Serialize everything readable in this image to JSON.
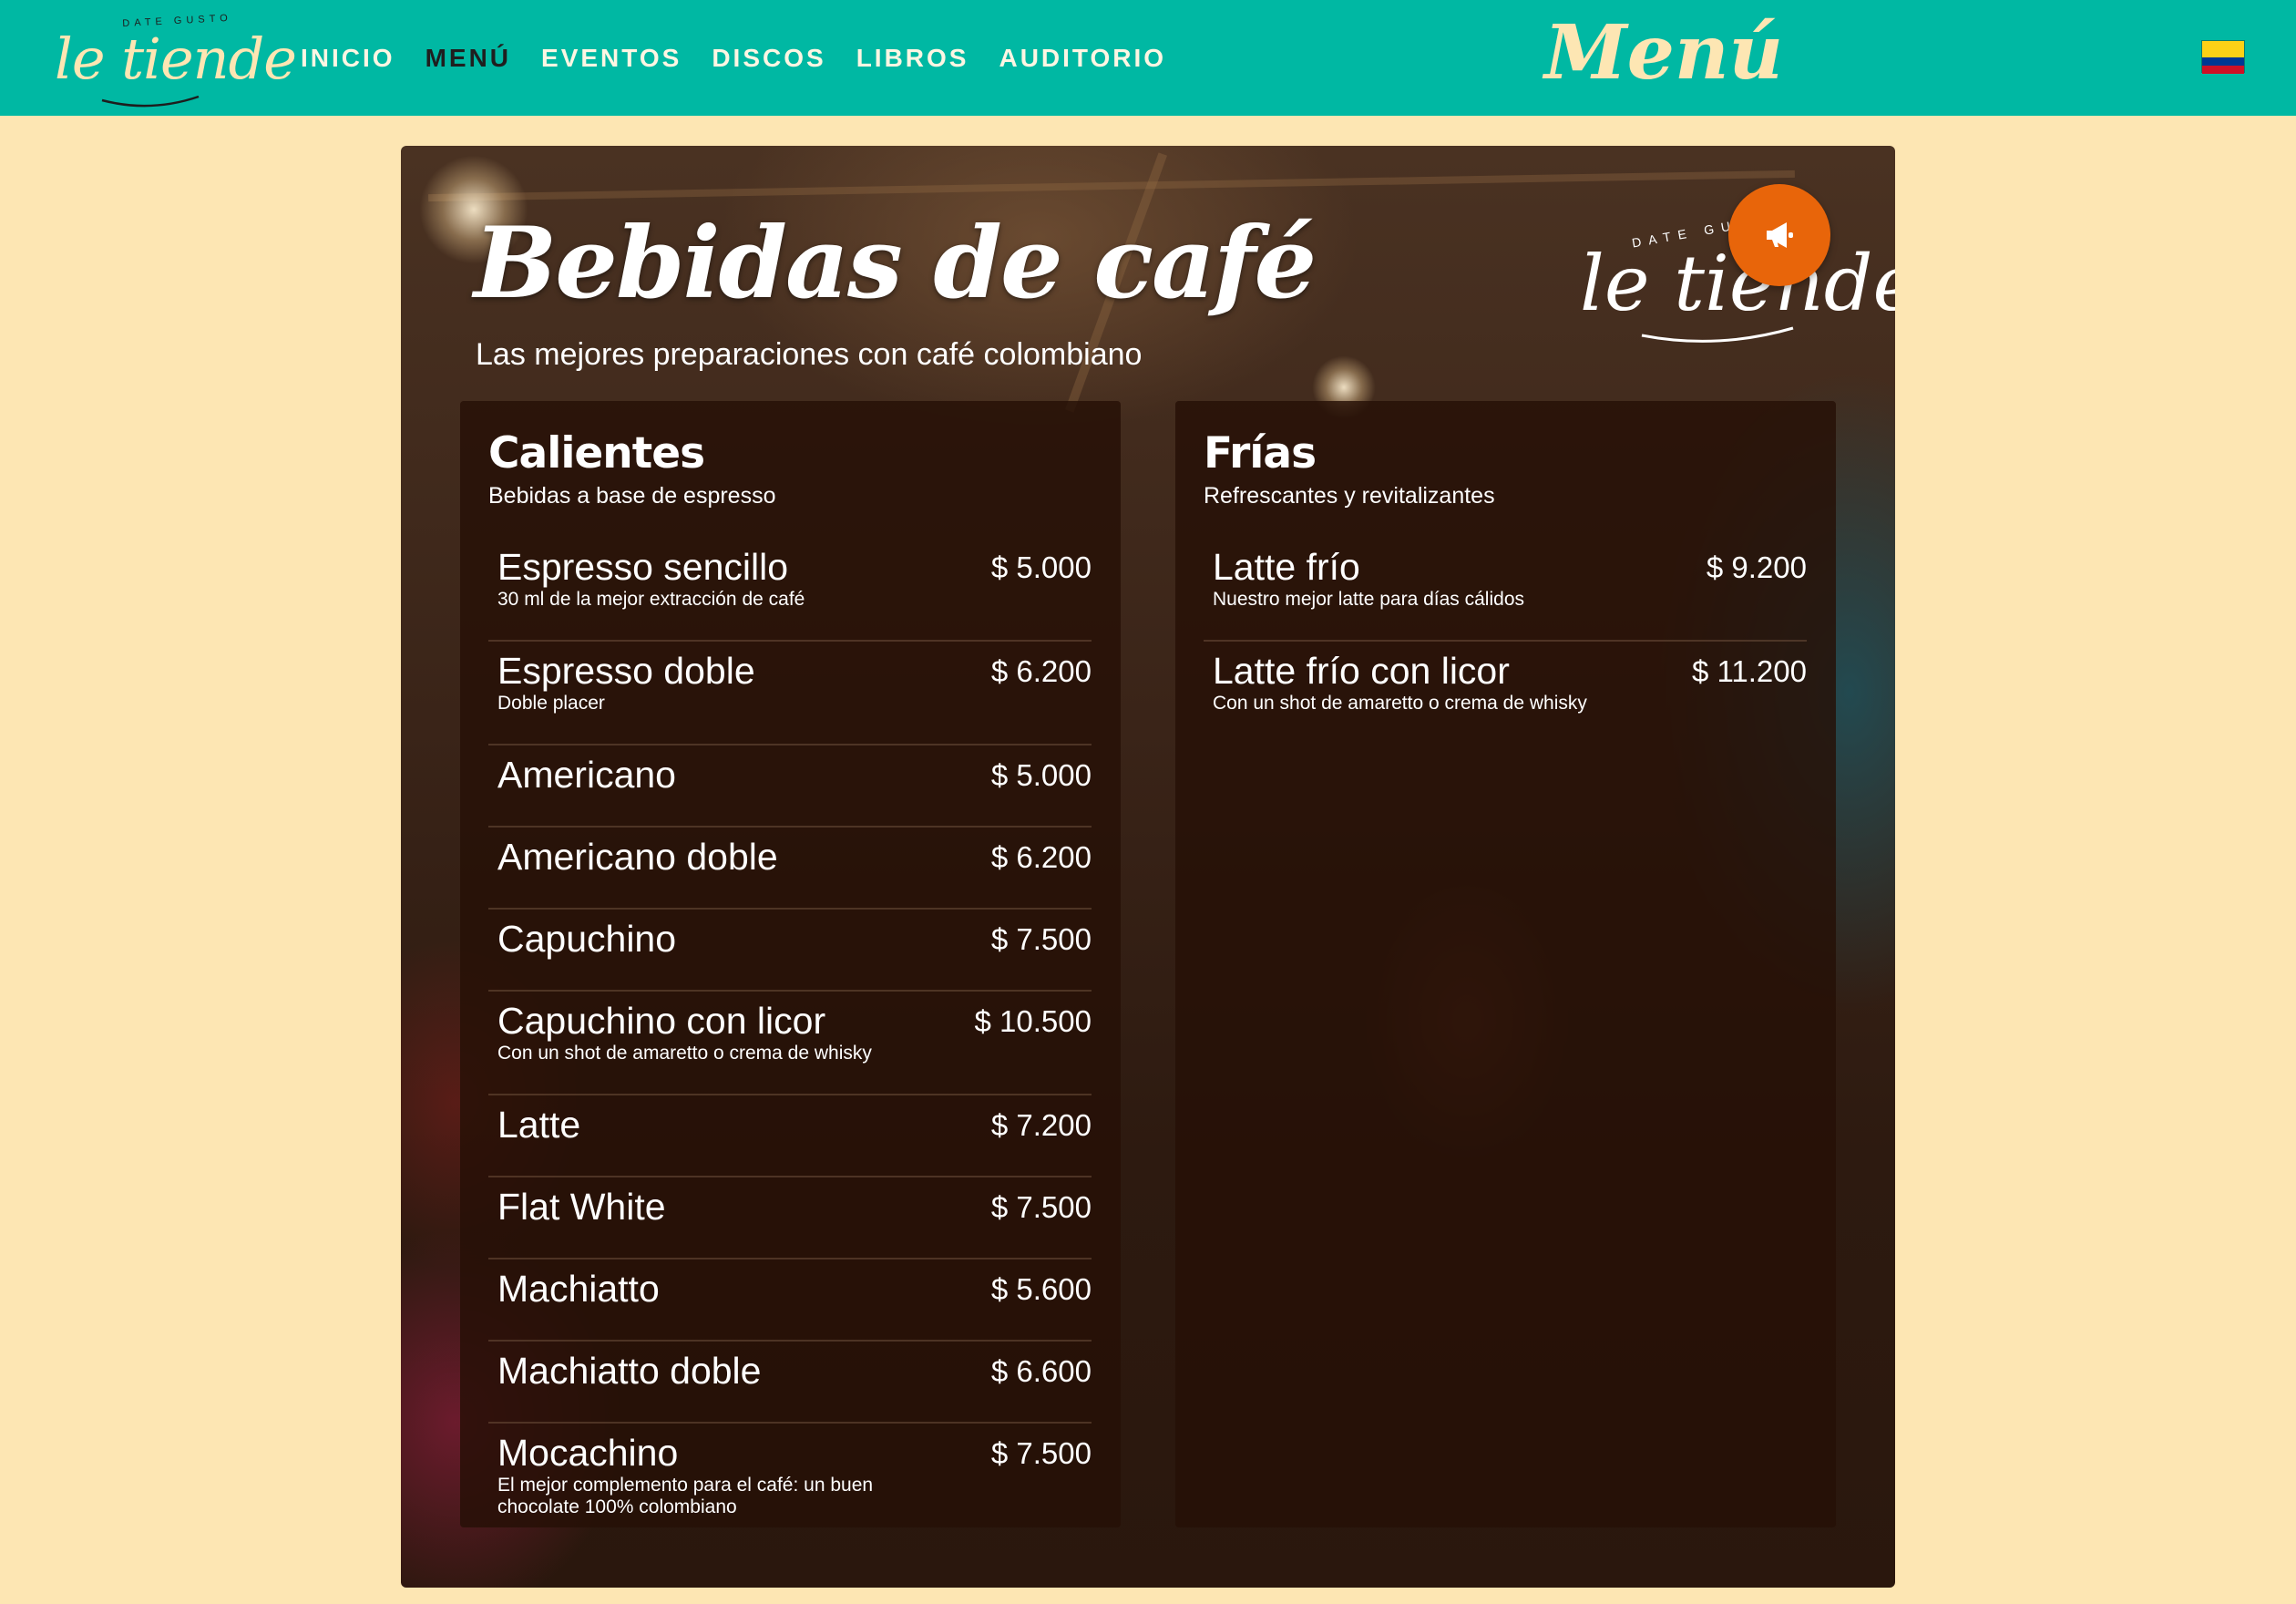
{
  "nav": {
    "brand_tag": "DATE GUSTO",
    "brand_name": "le tiende",
    "links": [
      "INICIO",
      "MENÚ",
      "EVENTOS",
      "DISCOS",
      "LIBROS",
      "AUDITORIO"
    ],
    "active_link": "MENÚ",
    "page_title": "Menú",
    "language_flag": "colombia-flag",
    "colors": {
      "bar": "#00b8a3",
      "brand": "#fde6b3"
    }
  },
  "panel": {
    "title": "Bebidas de café",
    "subtitle": "Las mejores preparaciones con café colombiano",
    "logo_tag": "DATE GUSTO",
    "logo_name": "le tiende",
    "announce_icon": "megaphone-icon",
    "announce_color": "#e8650a"
  },
  "calientes": {
    "title": "Calientes",
    "subtitle": "Bebidas a base de espresso",
    "items": [
      {
        "name": "Espresso sencillo",
        "desc": "30 ml de la mejor extracción de café",
        "price": "$ 5.000"
      },
      {
        "name": "Espresso doble",
        "desc": "Doble placer",
        "price": "$ 6.200"
      },
      {
        "name": "Americano",
        "desc": "",
        "price": "$ 5.000"
      },
      {
        "name": "Americano doble",
        "desc": "",
        "price": "$ 6.200"
      },
      {
        "name": "Capuchino",
        "desc": "",
        "price": "$ 7.500"
      },
      {
        "name": "Capuchino con licor",
        "desc": "Con un shot de amaretto o crema de whisky",
        "price": "$ 10.500"
      },
      {
        "name": "Latte",
        "desc": "",
        "price": "$ 7.200"
      },
      {
        "name": "Flat White",
        "desc": "",
        "price": "$ 7.500"
      },
      {
        "name": "Machiatto",
        "desc": "",
        "price": "$ 5.600"
      },
      {
        "name": "Machiatto doble",
        "desc": "",
        "price": "$ 6.600"
      },
      {
        "name": "Mocachino",
        "desc": "El mejor complemento para el café: un buen chocolate 100% colombiano",
        "price": "$ 7.500"
      }
    ]
  },
  "frias": {
    "title": "Frías",
    "subtitle": "Refrescantes y revitalizantes",
    "items": [
      {
        "name": "Latte frío",
        "desc": "Nuestro mejor latte para días cálidos",
        "price": "$ 9.200"
      },
      {
        "name": "Latte frío con licor",
        "desc": "Con un shot de amaretto o crema de whisky",
        "price": "$ 11.200"
      }
    ]
  }
}
